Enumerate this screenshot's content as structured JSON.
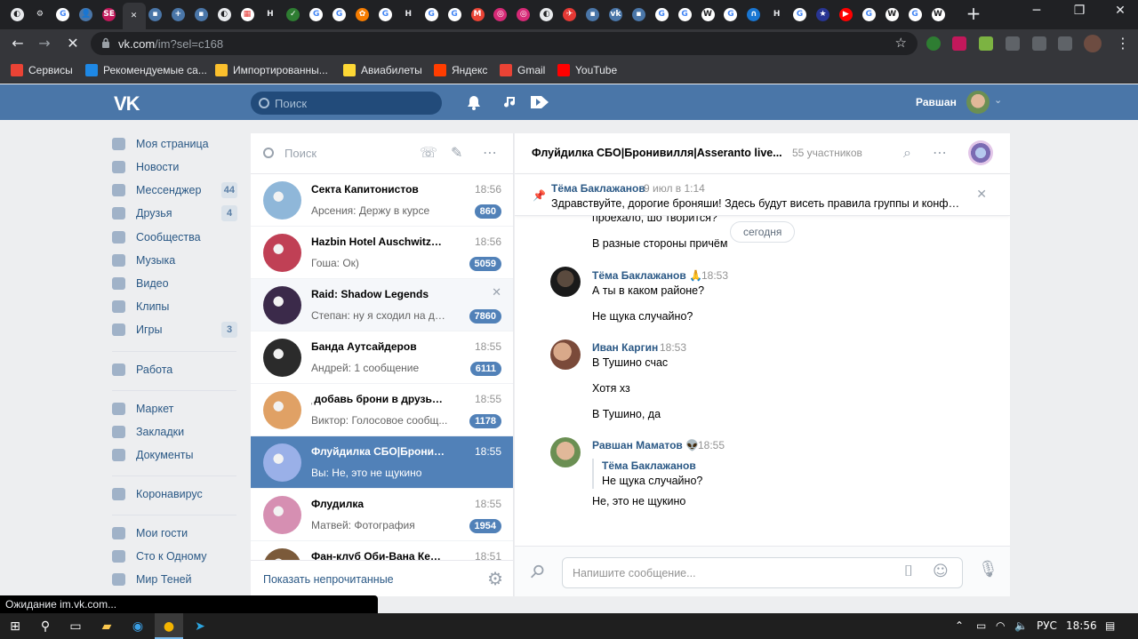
{
  "browser": {
    "tabs": [
      {
        "color": "#e8eaed",
        "glyph": "◐",
        "fg": "#202124"
      },
      {
        "color": "#202124",
        "glyph": "⚙",
        "fg": "#e8eaed"
      },
      {
        "color": "#ffffff",
        "glyph": "G",
        "fg": "#4285f4"
      },
      {
        "color": "#4a76a8",
        "glyph": "👤",
        "fg": "#ffffff"
      },
      {
        "color": "#c2185b",
        "glyph": "SE",
        "fg": "#ffffff"
      },
      {
        "color": "#35363a",
        "glyph": "✕",
        "fg": "#e8eaed",
        "active": true
      },
      {
        "color": "#4a76a8",
        "glyph": "▪",
        "fg": "#ffffff"
      },
      {
        "color": "#4a76a8",
        "glyph": "+",
        "fg": "#ffffff"
      },
      {
        "color": "#4a76a8",
        "glyph": "▪",
        "fg": "#ffffff"
      },
      {
        "color": "#e8eaed",
        "glyph": "◐",
        "fg": "#202124"
      },
      {
        "color": "#ffffff",
        "glyph": "▦",
        "fg": "#e53935"
      },
      {
        "color": "#202124",
        "glyph": "H",
        "fg": "#e8eaed"
      },
      {
        "color": "#2e7d32",
        "glyph": "✓",
        "fg": "#ffffff"
      },
      {
        "color": "#ffffff",
        "glyph": "G",
        "fg": "#4285f4"
      },
      {
        "color": "#ffffff",
        "glyph": "G",
        "fg": "#4285f4"
      },
      {
        "color": "#f57c00",
        "glyph": "✿",
        "fg": "#ffffff"
      },
      {
        "color": "#ffffff",
        "glyph": "G",
        "fg": "#4285f4"
      },
      {
        "color": "#202124",
        "glyph": "H",
        "fg": "#e8eaed"
      },
      {
        "color": "#ffffff",
        "glyph": "G",
        "fg": "#4285f4"
      },
      {
        "color": "#ffffff",
        "glyph": "G",
        "fg": "#4285f4"
      },
      {
        "color": "#ea4335",
        "glyph": "M",
        "fg": "#ffffff"
      },
      {
        "color": "#d62976",
        "glyph": "◎",
        "fg": "#ffffff"
      },
      {
        "color": "#d62976",
        "glyph": "◎",
        "fg": "#ffffff"
      },
      {
        "color": "#e8eaed",
        "glyph": "◐",
        "fg": "#202124"
      },
      {
        "color": "#e53935",
        "glyph": "✈",
        "fg": "#ffffff"
      },
      {
        "color": "#4a76a8",
        "glyph": "▪",
        "fg": "#ffffff"
      },
      {
        "color": "#4a76a8",
        "glyph": "vk",
        "fg": "#ffffff"
      },
      {
        "color": "#4a76a8",
        "glyph": "▪",
        "fg": "#ffffff"
      },
      {
        "color": "#ffffff",
        "glyph": "G",
        "fg": "#4285f4"
      },
      {
        "color": "#ffffff",
        "glyph": "G",
        "fg": "#4285f4"
      },
      {
        "color": "#ffffff",
        "glyph": "W",
        "fg": "#202124"
      },
      {
        "color": "#ffffff",
        "glyph": "G",
        "fg": "#4285f4"
      },
      {
        "color": "#1976d2",
        "glyph": "∩",
        "fg": "#ffffff"
      },
      {
        "color": "#202124",
        "glyph": "H",
        "fg": "#e8eaed"
      },
      {
        "color": "#ffffff",
        "glyph": "G",
        "fg": "#4285f4"
      },
      {
        "color": "#283593",
        "glyph": "★",
        "fg": "#ffffff"
      },
      {
        "color": "#ff0000",
        "glyph": "▶",
        "fg": "#ffffff"
      },
      {
        "color": "#ffffff",
        "glyph": "G",
        "fg": "#4285f4"
      },
      {
        "color": "#ffffff",
        "glyph": "W",
        "fg": "#202124"
      },
      {
        "color": "#ffffff",
        "glyph": "G",
        "fg": "#4285f4"
      },
      {
        "color": "#ffffff",
        "glyph": "W",
        "fg": "#202124"
      }
    ],
    "url_host": "vk.com",
    "url_path": "/im?sel=c168",
    "bookmarks": [
      {
        "label": "Сервисы",
        "color": "#ea4335"
      },
      {
        "label": "Рекомендуемые са...",
        "color": "#1e88e5"
      },
      {
        "label": "Импортированны...",
        "color": "#fbc02d"
      },
      {
        "label": "Авиабилеты",
        "color": "#fdd835"
      },
      {
        "label": "Яндекс",
        "color": "#ff3d00"
      },
      {
        "label": "Gmail",
        "color": "#ea4335"
      },
      {
        "label": "YouTube",
        "color": "#ff0000"
      }
    ],
    "status_text": "Ожидание im.vk.com..."
  },
  "vk": {
    "search_placeholder": "Поиск",
    "user_name": "Равшан"
  },
  "nav": [
    {
      "label": "Моя страница",
      "count": ""
    },
    {
      "label": "Новости",
      "count": ""
    },
    {
      "label": "Мессенджер",
      "count": "44"
    },
    {
      "label": "Друзья",
      "count": "4"
    },
    {
      "label": "Сообщества",
      "count": ""
    },
    {
      "label": "Музыка",
      "count": ""
    },
    {
      "label": "Видео",
      "count": ""
    },
    {
      "label": "Клипы",
      "count": ""
    },
    {
      "label": "Игры",
      "count": "3"
    },
    {
      "label": "Работа",
      "count": ""
    },
    {
      "label": "Маркет",
      "count": ""
    },
    {
      "label": "Закладки",
      "count": ""
    },
    {
      "label": "Документы",
      "count": ""
    },
    {
      "label": "Коронавирус",
      "count": ""
    },
    {
      "label": "Мои гости",
      "count": ""
    },
    {
      "label": "Сто к Одному",
      "count": ""
    },
    {
      "label": "Мир Теней",
      "count": ""
    }
  ],
  "dialogs": {
    "search_placeholder": "Поиск",
    "footer_label": "Показать непрочитанные",
    "items": [
      {
        "name": "Секта Капитонистов",
        "time": "18:56",
        "preview": "Арсения: Держу в курсе",
        "badge": "860",
        "ava": "#8fb7d9"
      },
      {
        "name": "Hazbin Hotel Auschwitz | ч...",
        "time": "18:56",
        "preview": "Гоша: Ок)",
        "badge": "5059",
        "ava": "#c04055"
      },
      {
        "name": "Raid: Shadow Legends",
        "time": "",
        "preview": "Степан: ну я сходил на др...",
        "badge": "7860",
        "ava": "#3b2a4a",
        "hover": true
      },
      {
        "name": "Банда Аутсайдеров",
        "time": "18:55",
        "preview": "Андрей: 1 сообщение",
        "badge": "6111",
        "ava": "#2b2b2b"
      },
      {
        "name": "ֶ добавь брони в друзья ...",
        "time": "18:55",
        "preview": "Виктор: Голосовое сообщ...",
        "badge": "1178",
        "ava": "#e0a165"
      },
      {
        "name": "Флуйдилка СБО|Бронииви...",
        "time": "18:55",
        "preview": "Вы: Не, это не щукино",
        "badge": "",
        "ava": "#9ab0e8",
        "selected": true
      },
      {
        "name": "Флудилка",
        "time": "18:55",
        "preview": "Матвей: Фотография",
        "badge": "1954",
        "ava": "#d68fb2"
      },
      {
        "name": "Фан-клуб Оби-Вана Кеноби",
        "time": "18:51",
        "preview": "",
        "badge": "",
        "ava": "#7b5a3a"
      }
    ]
  },
  "chat": {
    "title": "Флуйдилка СБО|Бронивилля|Asseranto live...",
    "members": "55 участников",
    "pinned": {
      "author": "Тёма Баклажанов",
      "date": "9 июл в 1:14",
      "text": "Здравствуйте, дорогие броняши! Здесь будут висеть правила группы и конфы. ..."
    },
    "day_label": "сегодня",
    "partial_top": "проехало, шо творится?",
    "line_1": "В разные стороны причём",
    "msg1": {
      "author": "Тёма Баклажанов 🙏",
      "time": "18:53",
      "lines": [
        "А ты в каком районе?",
        "Не щука случайно?"
      ]
    },
    "msg2": {
      "author": "Иван Каргин",
      "time": "18:53",
      "lines": [
        "В Тушино счас",
        "Хотя хз",
        "В Тушино, да"
      ]
    },
    "msg3": {
      "author": "Равшан Маматов 👽",
      "time": "18:55",
      "quote_author": "Тёма Баклажанов",
      "quote_text": "Не щука случайно?",
      "text": "Не, это не щукино"
    },
    "compose_placeholder": "Напишите сообщение..."
  },
  "taskbar": {
    "lang": "РУС",
    "clock": "18:56"
  }
}
